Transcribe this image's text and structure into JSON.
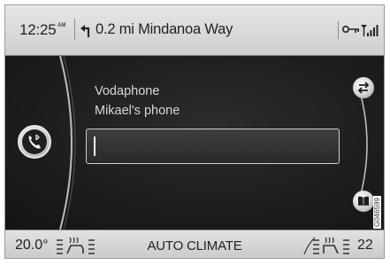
{
  "status_bar": {
    "time": "12:25",
    "ampm": "AM",
    "navigation": "0.2 mi Mindanoa Way",
    "icons": [
      "turn-left-arrow-icon",
      "key-icon",
      "signal-strength-icon"
    ]
  },
  "phone": {
    "operator": "Vodaphone",
    "device": "Mikael's phone",
    "number_value": "",
    "icons": [
      "bluetooth-phone-icon",
      "swap-icon",
      "phonebook-icon"
    ]
  },
  "climate": {
    "temp_left": "20.0°",
    "label": "AUTO CLIMATE",
    "temp_right": "22",
    "icons": [
      "seat-heat-left-icon",
      "seat-heat-right-icon"
    ]
  },
  "figure_code": "G046599"
}
